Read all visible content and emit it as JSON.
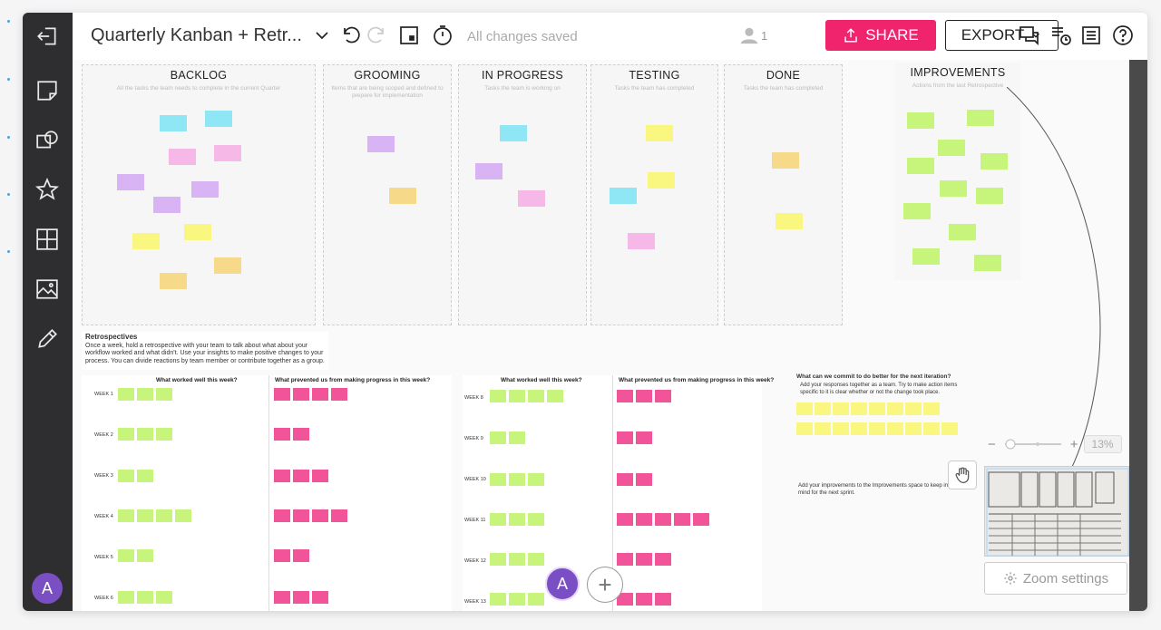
{
  "board": {
    "title": "Quarterly Kanban + Retr...",
    "save_status": "All changes saved",
    "user_count": "1"
  },
  "toolbar": {
    "share_label": "SHARE",
    "export_label": "EXPORT"
  },
  "columns": [
    {
      "title": "BACKLOG",
      "subtitle": "All the tasks the team needs to complete in the current Quarter"
    },
    {
      "title": "GROOMING",
      "subtitle": "Items that are being scoped and defined to prepare for implementation"
    },
    {
      "title": "IN PROGRESS",
      "subtitle": "Tasks the team is working on"
    },
    {
      "title": "TESTING",
      "subtitle": "Tasks the team has completed"
    },
    {
      "title": "DONE",
      "subtitle": "Tasks the team has completed"
    }
  ],
  "improvements": {
    "title": "IMPROVEMENTS",
    "subtitle": "Actions from the last Retrospective"
  },
  "retrospectives": {
    "title": "Retrospectives",
    "body": "Once a week, hold a retrospective with your team to talk about what about your workflow worked and what didn't. Use your insights to make positive changes to your process. You can divide reactions by team member or contribute together as a group.",
    "col_worked": "What worked well this week?",
    "col_prevented": "What prevented us from making progress in this week?",
    "weeks_left": [
      "WEEK 1",
      "WEEK 2",
      "WEEK 3",
      "WEEK 4",
      "WEEK 5",
      "WEEK 6"
    ],
    "weeks_right": [
      "WEEK 8",
      "WEEK 9",
      "WEEK 10",
      "WEEK 11",
      "WEEK 12",
      "WEEK 13"
    ],
    "commit_title": "What can we commit to do better for the next iteration?",
    "commit_body": "Add your responses together as a team. Try to make action items specific to it is clear whether or not the change took place.",
    "improve_note": "Add your improvements to the Improvements space to keep in mind for the next sprint."
  },
  "zoom": {
    "minus": "−",
    "plus": "+",
    "percent": "13%",
    "settings_label": "Zoom settings"
  },
  "avatar_initial": "A",
  "cursor_avatar_initial": "A",
  "add_label": "+",
  "icons": {
    "exit": "exit-icon",
    "sticky": "sticky-note-icon",
    "shapes": "shapes-icon",
    "star": "star-icon",
    "grid": "grid-template-icon",
    "image": "image-icon",
    "pencil": "pencil-icon"
  },
  "colors": {
    "share": "#f0246d",
    "sidebar": "#2e2e30",
    "avatar": "#7b4fc4"
  }
}
